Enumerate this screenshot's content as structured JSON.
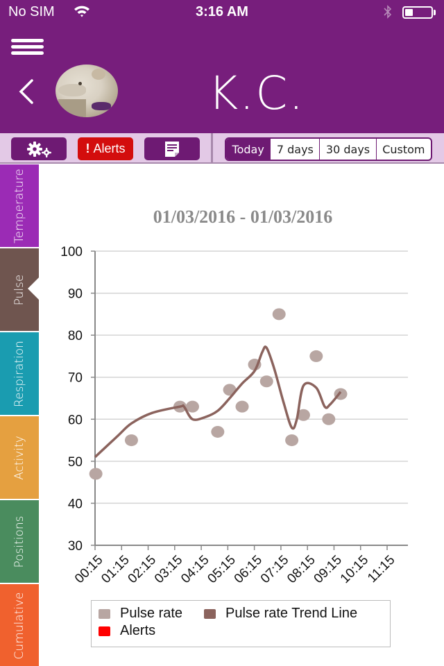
{
  "status_bar": {
    "carrier": "No SIM",
    "time": "3:16 AM",
    "battery_level": 0.3,
    "icons": [
      "wifi-icon",
      "bluetooth-icon",
      "battery-icon"
    ]
  },
  "header": {
    "pet_name": "K.C.",
    "menu_icon": "hamburger-menu-icon",
    "back_icon": "chevron-left-icon",
    "avatar": "pet-photo-dog"
  },
  "toolbar": {
    "settings_icon": "gears-icon",
    "alerts_label": "Alerts",
    "alerts_excl": "!",
    "notes_icon": "note-icon",
    "range_options": [
      "Today",
      "7 days",
      "30 days",
      "Custom"
    ],
    "selected_range": "Today"
  },
  "side_tabs": [
    {
      "label": "Temperature",
      "color": "#9b2bb5"
    },
    {
      "label": "Pulse",
      "color": "#6f554f",
      "active": true
    },
    {
      "label": "Respiration",
      "color": "#1a9cb0"
    },
    {
      "label": "Activity",
      "color": "#e5a040"
    },
    {
      "label": "Positions",
      "color": "#4a8c5e"
    },
    {
      "label": "Cumulative",
      "color": "#f0612e"
    }
  ],
  "chart_data": {
    "type": "scatter",
    "title": "01/03/2016 - 01/03/2016",
    "xlabel": "",
    "ylabel": "",
    "ylim": [
      30,
      100
    ],
    "yticks": [
      30,
      40,
      50,
      60,
      70,
      80,
      90,
      100
    ],
    "xticks": [
      "00:15",
      "01:15",
      "02:15",
      "03:15",
      "04:15",
      "05:15",
      "06:15",
      "07:15",
      "08:15",
      "09:15",
      "10:15",
      "11:15"
    ],
    "xlim_hours": [
      0.25,
      11.25
    ],
    "grid": true,
    "legend_position": "bottom",
    "series": [
      {
        "name": "Pulse rate",
        "color": "#b8a6a2",
        "kind": "scatter",
        "points": [
          {
            "x": 0.28,
            "y": 47
          },
          {
            "x": 1.62,
            "y": 55
          },
          {
            "x": 3.45,
            "y": 63
          },
          {
            "x": 3.92,
            "y": 63
          },
          {
            "x": 4.87,
            "y": 57
          },
          {
            "x": 5.32,
            "y": 67
          },
          {
            "x": 5.79,
            "y": 63
          },
          {
            "x": 6.26,
            "y": 73
          },
          {
            "x": 6.71,
            "y": 69
          },
          {
            "x": 7.18,
            "y": 85
          },
          {
            "x": 7.66,
            "y": 55
          },
          {
            "x": 8.1,
            "y": 61
          },
          {
            "x": 8.58,
            "y": 75
          },
          {
            "x": 9.05,
            "y": 60
          },
          {
            "x": 9.5,
            "y": 66
          }
        ]
      },
      {
        "name": "Pulse rate Trend Line",
        "color": "#8b635d",
        "kind": "line",
        "points": [
          {
            "x": 0.25,
            "y": 51
          },
          {
            "x": 1.1,
            "y": 56
          },
          {
            "x": 1.62,
            "y": 59
          },
          {
            "x": 2.4,
            "y": 61.5
          },
          {
            "x": 3.45,
            "y": 63
          },
          {
            "x": 3.6,
            "y": 63
          },
          {
            "x": 3.92,
            "y": 60
          },
          {
            "x": 4.4,
            "y": 60.5
          },
          {
            "x": 4.87,
            "y": 62
          },
          {
            "x": 5.32,
            "y": 65
          },
          {
            "x": 5.79,
            "y": 68.5
          },
          {
            "x": 6.26,
            "y": 71.5
          },
          {
            "x": 6.55,
            "y": 76
          },
          {
            "x": 6.71,
            "y": 77
          },
          {
            "x": 7.0,
            "y": 72
          },
          {
            "x": 7.35,
            "y": 64
          },
          {
            "x": 7.66,
            "y": 58
          },
          {
            "x": 7.85,
            "y": 60
          },
          {
            "x": 8.1,
            "y": 68
          },
          {
            "x": 8.58,
            "y": 67.5
          },
          {
            "x": 8.9,
            "y": 63
          },
          {
            "x": 9.1,
            "y": 63.5
          },
          {
            "x": 9.5,
            "y": 66.5
          }
        ]
      },
      {
        "name": "Alerts",
        "color": "#ff0000",
        "kind": "scatter",
        "points": []
      }
    ]
  }
}
